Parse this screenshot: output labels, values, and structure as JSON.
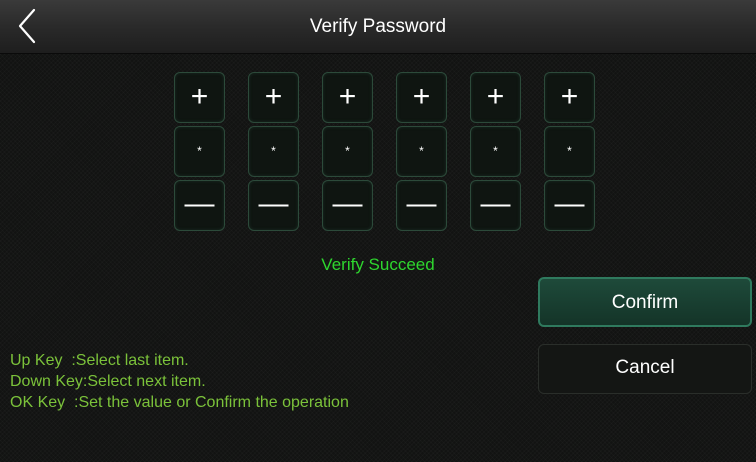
{
  "header": {
    "title": "Verify Password",
    "back_icon": "chevron-left-icon"
  },
  "password": {
    "increment_symbol": "+",
    "decrement_symbol": "—",
    "digits": [
      "*",
      "*",
      "*",
      "*",
      "*",
      "*"
    ]
  },
  "status": {
    "message": "Verify Succeed",
    "color": "#2ed62e"
  },
  "actions": {
    "confirm_label": "Confirm",
    "cancel_label": "Cancel"
  },
  "help": {
    "lines": [
      "Up Key  :Select last item.",
      "Down Key:Select next item.",
      "OK Key  :Set the value or Confirm the operation"
    ],
    "color": "#7bc23a"
  }
}
